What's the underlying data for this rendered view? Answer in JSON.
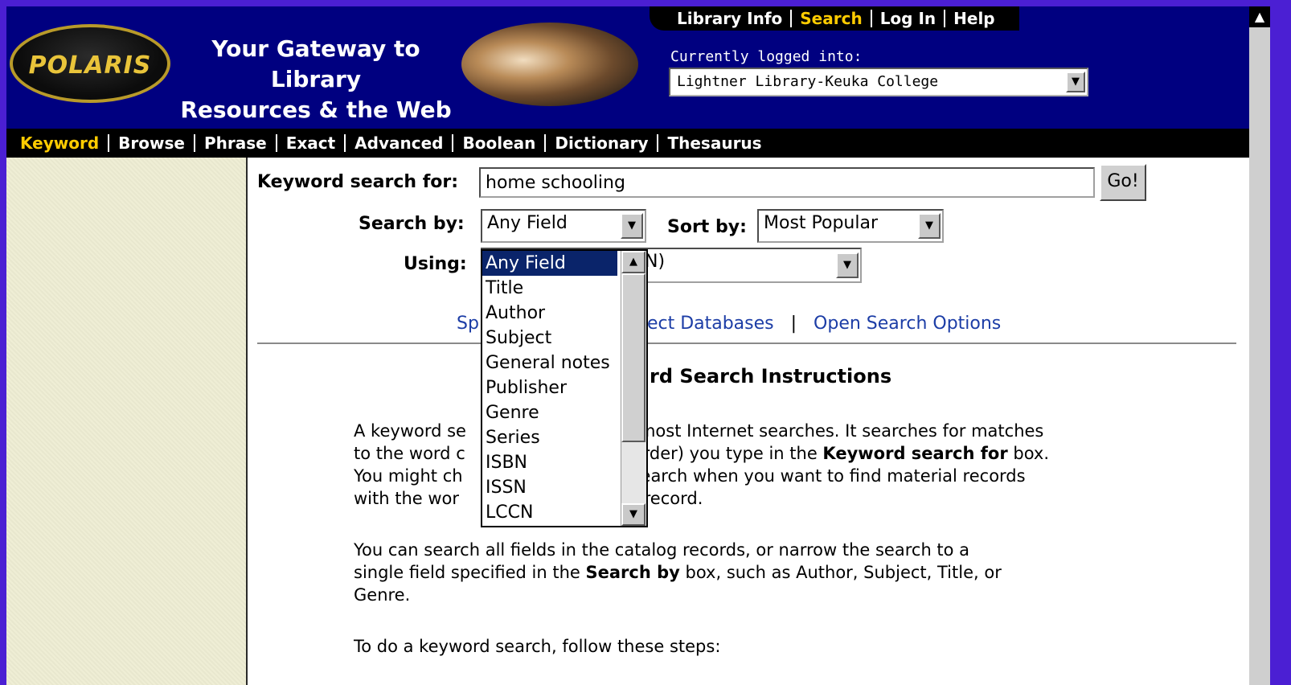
{
  "header": {
    "logo_text": "POLARIS",
    "tagline_line1": "Your Gateway to Library",
    "tagline_line2": "Resources & the Web",
    "logged_in_label": "Currently logged into:",
    "library_selected": "Lightner Library-Keuka College"
  },
  "top_nav": {
    "items": [
      "Library Info",
      "Search",
      "Log In",
      "Help"
    ],
    "active": "Search"
  },
  "search_tabs": {
    "items": [
      "Keyword",
      "Browse",
      "Phrase",
      "Exact",
      "Advanced",
      "Boolean",
      "Dictionary",
      "Thesaurus"
    ],
    "active": "Keyword"
  },
  "search_form": {
    "keyword_label": "Keyword search for:",
    "keyword_value": "home schooling",
    "go_label": "Go!",
    "search_by_label": "Search by:",
    "search_by_value": "Any Field",
    "sort_by_label": "Sort by:",
    "sort_by_value": "Most Popular",
    "using_label": "Using:",
    "using_value_visible": "N)"
  },
  "links": {
    "left_fragment": "Sp",
    "middle_fragment": "ect Databases",
    "open_options": "Open Search Options"
  },
  "instructions": {
    "title_fragment": "rd Search Instructions",
    "para1_line1_a": "A keyword se",
    "para1_line1_b": "most Internet searches. It searches for matches",
    "para1_line2_a": "to the word c",
    "para1_line2_b": "order) you type in the ",
    "para1_line2_bold": "Keyword search for",
    "para1_line2_c": " box.",
    "para1_line3_a": "You might ch",
    "para1_line3_b": "search when you want to find material records",
    "para1_line4_a": "with the wor",
    "para1_line4_b": "e record.",
    "para2_line1": "You can search all fields in the catalog records, or narrow the search to a",
    "para2_line2_a": "single field specified in the ",
    "para2_line2_bold": "Search by",
    "para2_line2_b": " box, such as Author, Subject, Title, or",
    "para2_line3": "Genre.",
    "para3": "To do a keyword search, follow these steps:"
  },
  "dropdown": {
    "options": [
      "Any Field",
      "Title",
      "Author",
      "Subject",
      "General notes",
      "Publisher",
      "Genre",
      "Series",
      "ISBN",
      "ISSN",
      "LCCN"
    ],
    "selected_index": 0
  },
  "colors": {
    "header_bg": "#000080",
    "nav_bg": "#000000",
    "active_tab": "#ffcc00",
    "link": "#1c3da6",
    "outer_bg": "#4b1fd3",
    "left_panel": "#efeed5"
  }
}
